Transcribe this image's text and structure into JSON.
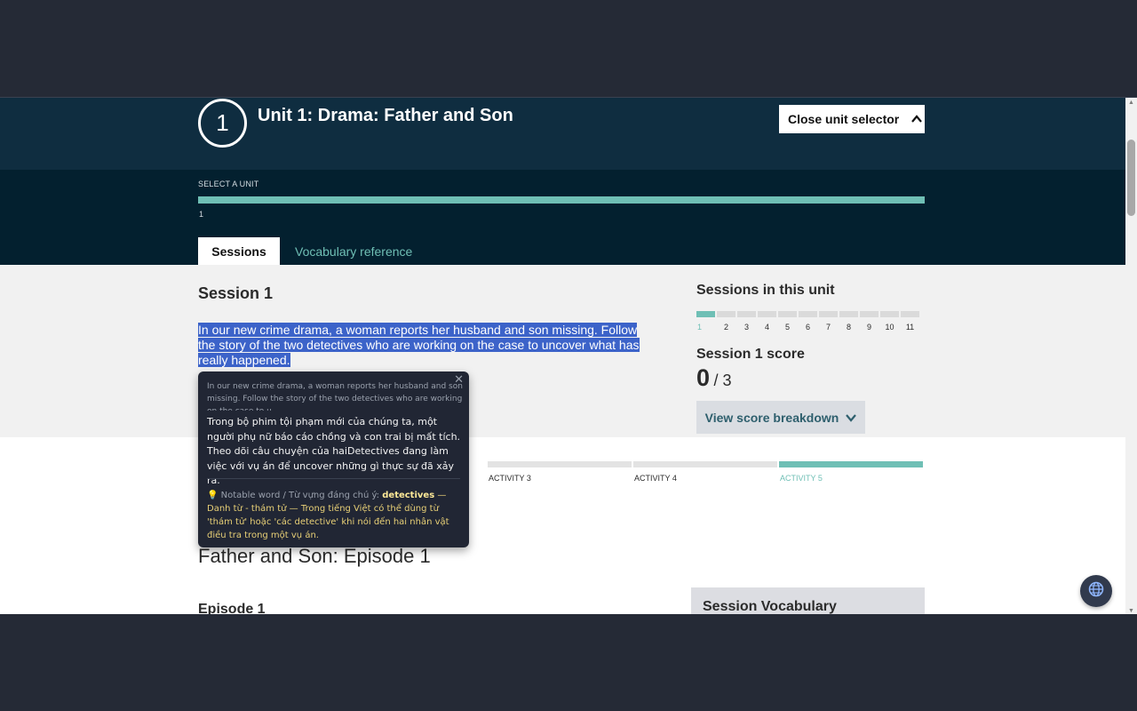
{
  "unit": {
    "number": "1",
    "title": "Unit 1: Drama: Father and Son",
    "close_selector_label": "Close unit selector",
    "select_label": "SELECT A UNIT",
    "selected_unit": "1"
  },
  "tabs": [
    {
      "label": "Sessions",
      "active": true
    },
    {
      "label": "Vocabulary reference",
      "active": false
    }
  ],
  "session": {
    "title": "Session 1",
    "description": "In our new crime drama, a woman reports her husband and son missing. Follow the story of the two detectives who are working on the case to uncover what has really happened."
  },
  "sessions_in_unit": {
    "title": "Sessions in this unit",
    "numbers": [
      "1",
      "2",
      "3",
      "4",
      "5",
      "6",
      "7",
      "8",
      "9",
      "10",
      "11"
    ],
    "active_index": 0
  },
  "score": {
    "title": "Session 1 score",
    "value": "0",
    "total": "/ 3",
    "button_label": "View score breakdown"
  },
  "activities": {
    "labels": [
      "ACTIVITY 3",
      "ACTIVITY 4",
      "ACTIVITY 5"
    ],
    "active_label": "ACTIVITY 5"
  },
  "episode": {
    "heading": "Father and Son: Episode 1",
    "subheading": "Episode 1",
    "vocab_title": "Session Vocabulary"
  },
  "tooltip": {
    "source_text": "In our new crime drama, a woman reports her husband and son missing. Follow the story of the two detectives who are working on the case to u",
    "translation": "Trong bộ phim tội phạm mới của chúng ta, một người phụ nữ báo cáo chồng và con trai bị mất tích. Theo dõi câu chuyện của haiDetectives đang làm việc với vụ án để uncover những gì thực sự đã xảy ra.",
    "note_label": "Notable word / Từ vựng đáng chú ý:",
    "note_word": "detectives",
    "note_text": "— Danh từ - thám tử — Trong tiếng Việt có thể dùng từ 'thám tử' hoặc 'các detective' khi nói đến hai nhân vật điều tra trong một vụ án."
  },
  "colors": {
    "header_bg": "#0f2d40",
    "select_bg": "#03202f",
    "accent_teal": "#6fbfb5",
    "selection_blue": "#3c63c9",
    "tooltip_bg": "#212634"
  },
  "icons": [
    "chevron-up-icon",
    "chevron-down-icon",
    "close-icon",
    "lightbulb-icon",
    "globe-icon"
  ]
}
